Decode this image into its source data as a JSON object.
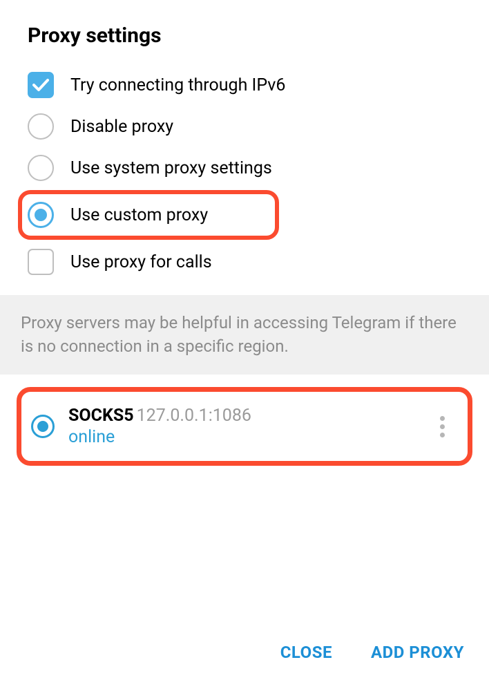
{
  "title": "Proxy settings",
  "options": {
    "ipv6": {
      "label": "Try connecting through IPv6",
      "checked": true
    },
    "disable": {
      "label": "Disable proxy",
      "selected": false
    },
    "system": {
      "label": "Use system proxy settings",
      "selected": false
    },
    "custom": {
      "label": "Use custom proxy",
      "selected": true
    },
    "calls": {
      "label": "Use proxy for calls",
      "checked": false
    }
  },
  "info_text": "Proxy servers may be helpful in accessing Telegram if there is no connection in a specific region.",
  "proxy": {
    "type": "SOCKS5",
    "address": "127.0.0.1:1086",
    "status": "online",
    "selected": true
  },
  "footer": {
    "close": "CLOSE",
    "add": "ADD PROXY"
  }
}
